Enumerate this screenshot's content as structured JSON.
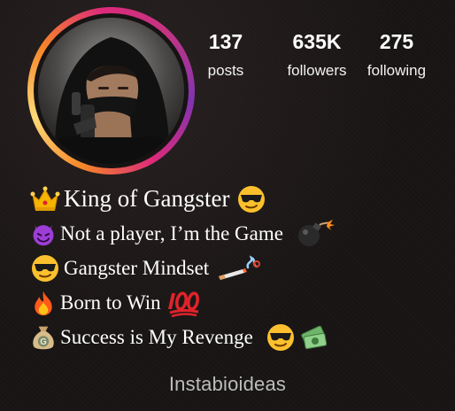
{
  "profile": {
    "avatar_icon": "hooded-person-photo",
    "stats": [
      {
        "value": "137",
        "label": "posts"
      },
      {
        "value": "635K",
        "label": "followers"
      },
      {
        "value": "275",
        "label": "following"
      }
    ]
  },
  "bio": {
    "lines": [
      {
        "text": "King of Gangster",
        "icons": [
          "crown-icon",
          "sunglasses-face-icon"
        ]
      },
      {
        "text": "Not a player, I’m the Game",
        "icons": [
          "smiling-devil-icon",
          "bomb-icon"
        ]
      },
      {
        "text": "Gangster Mindset",
        "icons": [
          "sunglasses-face-icon",
          "cigarette-smoke-icon"
        ]
      },
      {
        "text": "Born to Win",
        "icons": [
          "fire-icon",
          "hundred-points-icon"
        ]
      },
      {
        "text": "Success is My Revenge",
        "icons": [
          "money-bag-icon",
          "sunglasses-face-icon",
          "money-stack-icon"
        ]
      }
    ]
  },
  "watermark": "Instabioideas",
  "colors": {
    "background": "#181414",
    "ring_orange": "#f58529",
    "ring_pink": "#dd2a7b",
    "ring_purple": "#8134af",
    "hundred_red": "#e0232a"
  }
}
